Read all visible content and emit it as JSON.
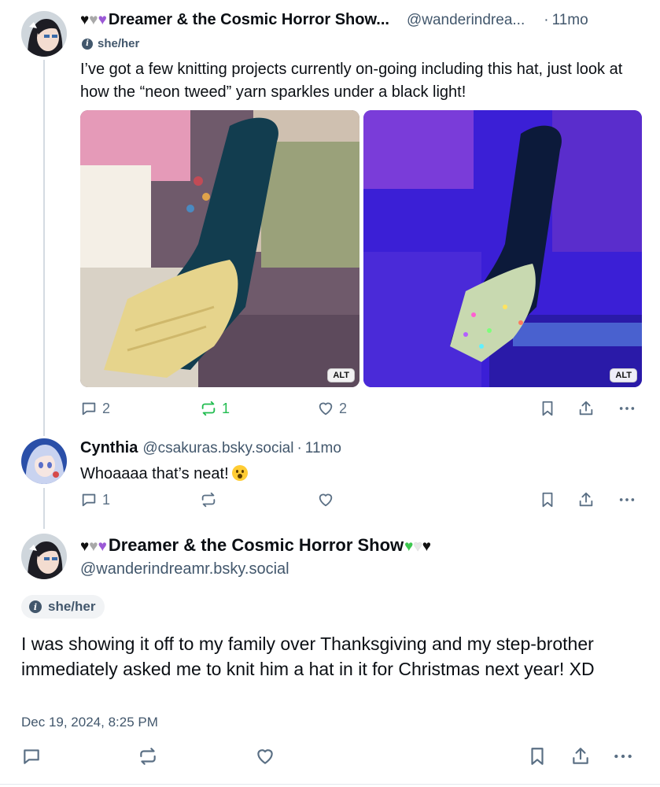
{
  "post1": {
    "display_name": "Dreamer & the Cosmic Horror Show...",
    "handle": "@wanderindrea...",
    "time_sep": "·",
    "time": "11mo",
    "pronouns": "she/her",
    "text": "I’ve got a few knitting projects currently on-going including this hat, just look at how the “neon tweed” yarn sparkles under a black light!",
    "images": [
      {
        "alt_badge": "ALT"
      },
      {
        "alt_badge": "ALT"
      }
    ],
    "replies": "2",
    "reposts": "1",
    "likes": "2"
  },
  "reply": {
    "display_name": "Cynthia",
    "handle": "@csakuras.bsky.social",
    "time_sep": "·",
    "time": "11mo",
    "text": "Whoaaaa that’s neat!",
    "replies": "1"
  },
  "main_post": {
    "display_name": "Dreamer & the Cosmic Horror Show",
    "handle": "@wanderindreamr.bsky.social",
    "pronouns": "she/her",
    "text": "I was showing it off to my family over Thanksgiving and my step-brother immediately asked me to knit him a hat in it for Christmas next year! XD",
    "timestamp": "Dec 19, 2024, 8:25 PM"
  },
  "colors": {
    "accent_repost": "#20bc4f",
    "muted": "#42576c",
    "icon": "#5a6f84",
    "heart_purple": "#9b59d6",
    "heart_green": "#3dc74f"
  },
  "icons": {
    "reply": "speech-bubble-icon",
    "repost": "repost-arrows-icon",
    "like": "heart-icon",
    "bookmark": "bookmark-icon",
    "share": "share-icon",
    "more": "more-dots-icon"
  }
}
